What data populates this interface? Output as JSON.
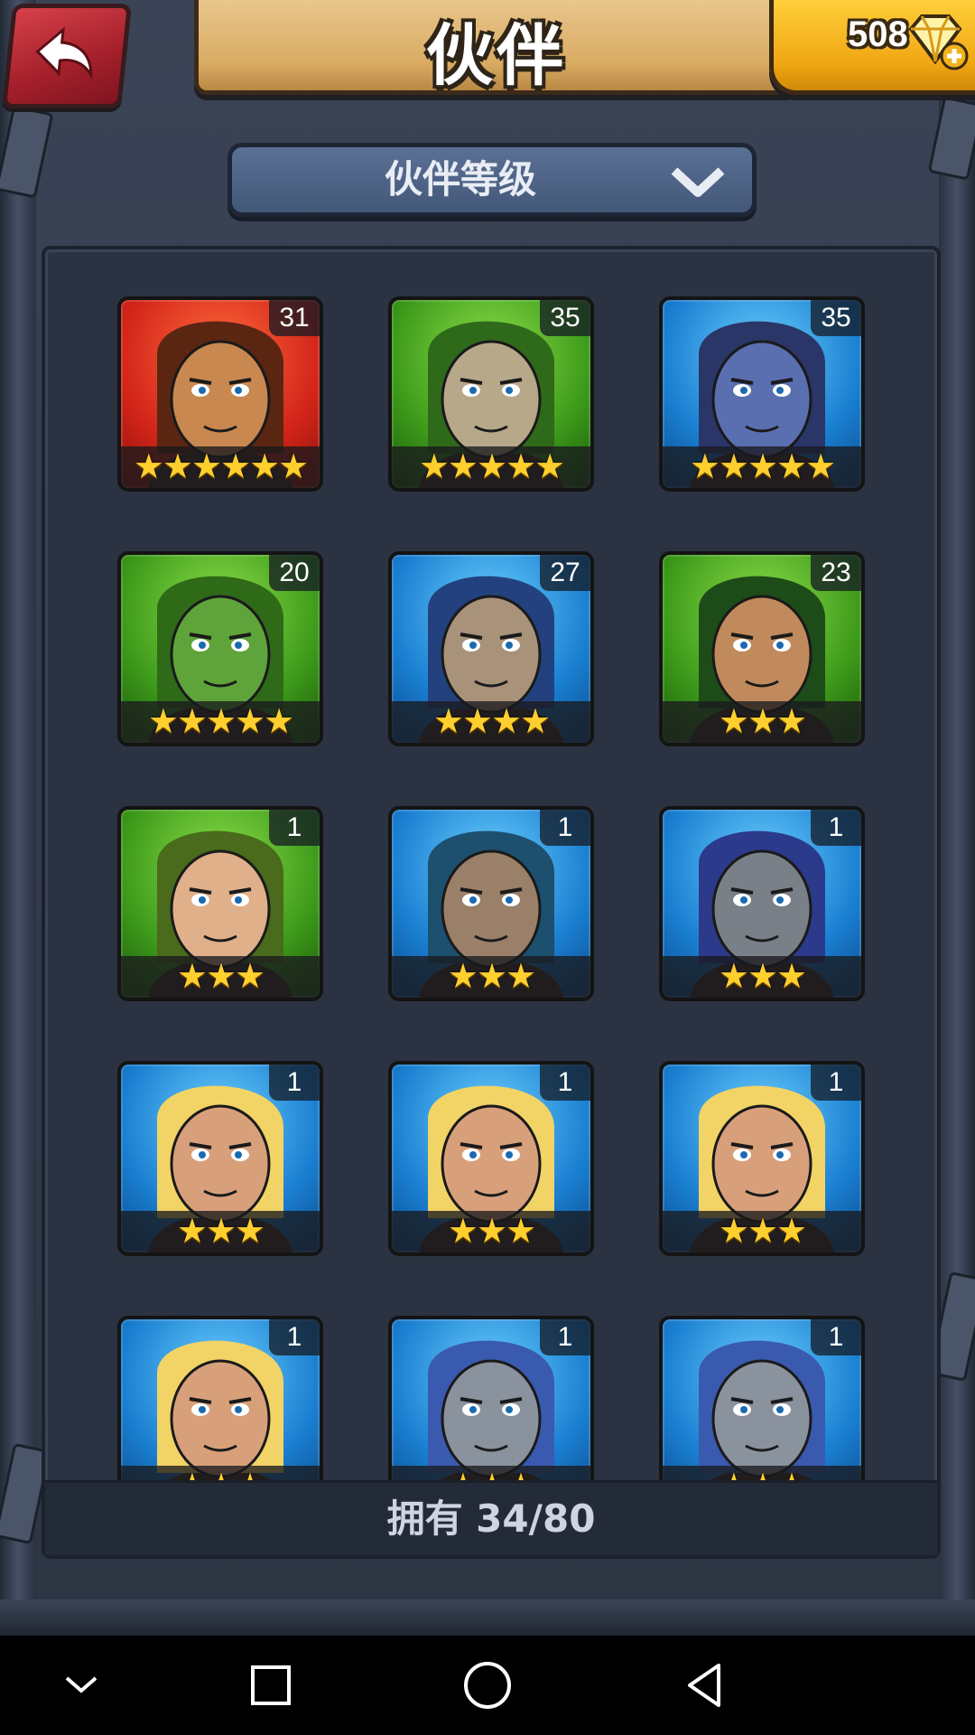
{
  "header": {
    "title": "伙伴",
    "gems": "508",
    "back_icon": "back-arrow-icon",
    "gem_icon": "diamond-plus-icon"
  },
  "filter": {
    "label": "伙伴等级",
    "icon": "chevron-down-icon"
  },
  "partners": [
    {
      "level": "31",
      "stars": "★★★★★★",
      "bg": "red",
      "face": "#c98850",
      "hair": "#5a2612"
    },
    {
      "level": "35",
      "stars": "★★★★★",
      "bg": "green",
      "face": "#b8a88a",
      "hair": "#2e6a1a"
    },
    {
      "level": "35",
      "stars": "★★★★★",
      "bg": "blue",
      "face": "#5a6fb0",
      "hair": "#2a3668"
    },
    {
      "level": "20",
      "stars": "★★★★★",
      "bg": "green",
      "face": "#5ea43a",
      "hair": "#2f6a18"
    },
    {
      "level": "27",
      "stars": "★★★★",
      "bg": "blue",
      "face": "#a8927a",
      "hair": "#23417e"
    },
    {
      "level": "23",
      "stars": "★★★",
      "bg": "green",
      "face": "#c08a5c",
      "hair": "#1e4c18"
    },
    {
      "level": "1",
      "stars": "★★★",
      "bg": "green",
      "face": "#e0b08a",
      "hair": "#4a6a1c"
    },
    {
      "level": "1",
      "stars": "★★★",
      "bg": "blue",
      "face": "#9a8068",
      "hair": "#1d4f6e"
    },
    {
      "level": "1",
      "stars": "★★★",
      "bg": "blue",
      "face": "#7a8088",
      "hair": "#2b3a8a"
    },
    {
      "level": "1",
      "stars": "★★★",
      "bg": "blue",
      "face": "#d8a07a",
      "hair": "#f2d466"
    },
    {
      "level": "1",
      "stars": "★★★",
      "bg": "blue",
      "face": "#d8a07a",
      "hair": "#f2d466"
    },
    {
      "level": "1",
      "stars": "★★★",
      "bg": "blue",
      "face": "#d8a07a",
      "hair": "#f2d466"
    },
    {
      "level": "1",
      "stars": "★★★",
      "bg": "blue",
      "face": "#d8a07a",
      "hair": "#f2d466"
    },
    {
      "level": "1",
      "stars": "★★★",
      "bg": "blue",
      "face": "#8a929e",
      "hair": "#3a5ab0"
    },
    {
      "level": "1",
      "stars": "★★★",
      "bg": "blue",
      "face": "#8a929e",
      "hair": "#3a5ab0"
    }
  ],
  "footer": {
    "owned": "拥有 34/80"
  },
  "navbar": {
    "back": "nav-back-icon",
    "home": "nav-home-icon",
    "recents": "nav-recents-icon",
    "collapse": "nav-collapse-icon"
  },
  "colors": {
    "gold": "#ffcf2e",
    "accent_red": "#c52a33",
    "panel": "#2b3342"
  }
}
